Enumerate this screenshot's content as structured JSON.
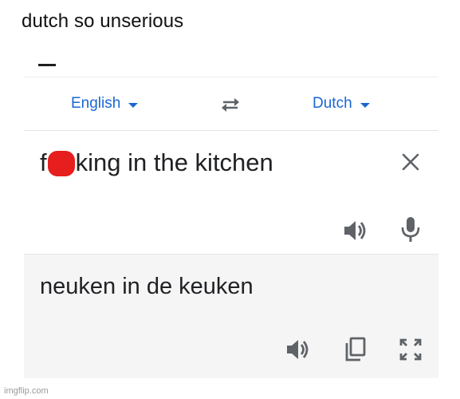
{
  "post": {
    "caption": "dutch so unserious"
  },
  "translator": {
    "source_language": "English",
    "target_language": "Dutch",
    "source_text_start": "f",
    "source_text_end": "king in the kitchen",
    "translated_text": "neuken in de keuken",
    "icons": {
      "swap": "swap-languages-icon",
      "clear": "close-icon",
      "source_listen": "speaker-icon",
      "mic": "microphone-icon",
      "target_listen": "speaker-icon",
      "copy": "copy-icon",
      "fullscreen": "fullscreen-icon"
    },
    "colors": {
      "accent": "#1a67d2",
      "censor": "#e61e1e",
      "icon": "#5f6368"
    }
  },
  "watermark": "imgflip.com"
}
